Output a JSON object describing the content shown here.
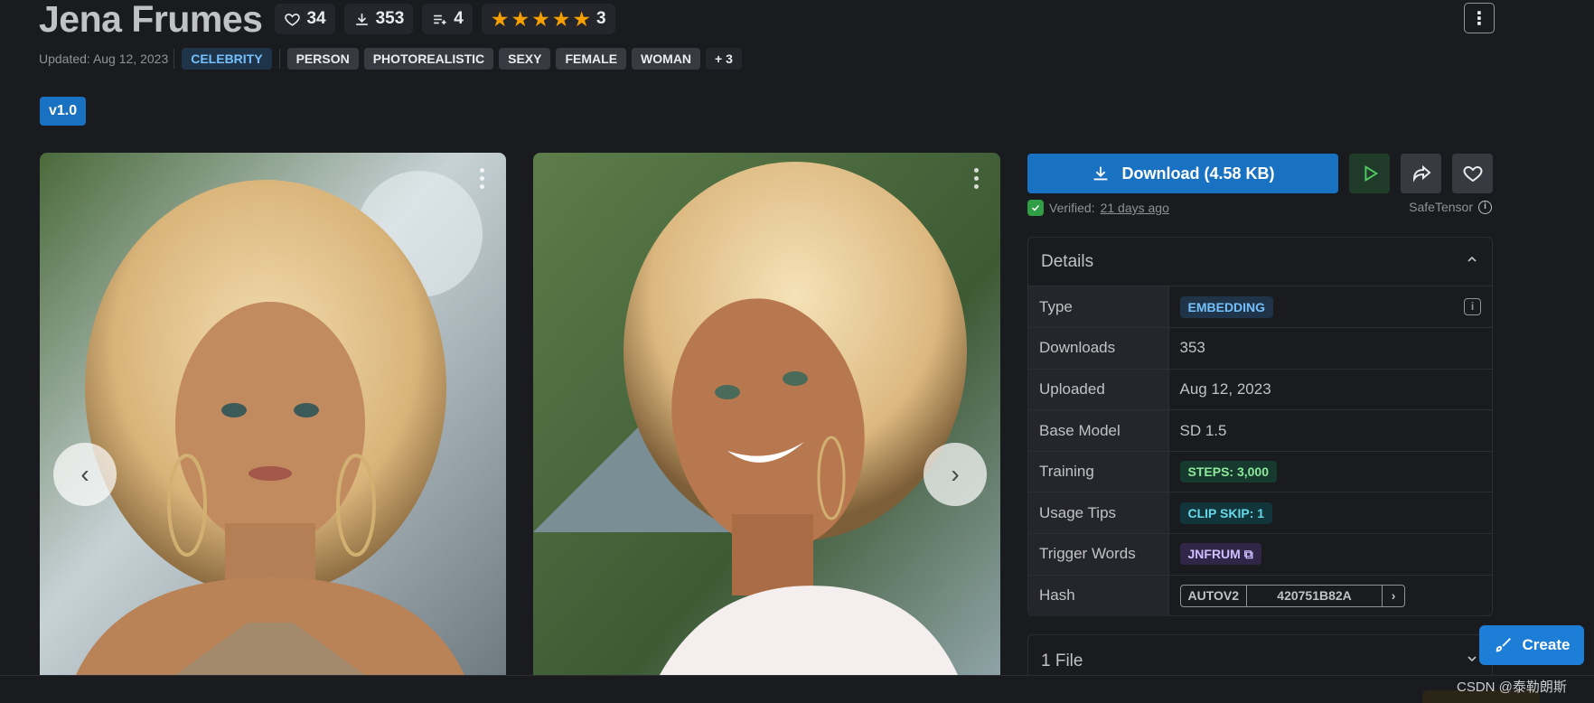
{
  "header": {
    "title": "Jena Frumes",
    "likes": "34",
    "downloads": "353",
    "collections": "4",
    "rating_count": "3",
    "rating_stars": 5
  },
  "meta": {
    "updated": "Updated: Aug 12, 2023",
    "tags": [
      "CELEBRITY",
      "PERSON",
      "PHOTOREALISTIC",
      "SEXY",
      "FEMALE",
      "WOMAN"
    ],
    "more_tags": "+ 3"
  },
  "version_label": "v1.0",
  "gallery": {
    "prev_icon": "chevron-left-icon",
    "next_icon": "chevron-right-icon"
  },
  "actions": {
    "download_label": "Download (4.58 KB)",
    "verified_prefix": "Verified:",
    "verified_when": "21 days ago",
    "safetensor_label": "SafeTensor"
  },
  "details": {
    "title": "Details",
    "rows": [
      {
        "key": "Type",
        "value": "EMBEDDING"
      },
      {
        "key": "Downloads",
        "value": "353"
      },
      {
        "key": "Uploaded",
        "value": "Aug 12, 2023"
      },
      {
        "key": "Base Model",
        "value": "SD 1.5"
      },
      {
        "key": "Training",
        "value": "STEPS: 3,000"
      },
      {
        "key": "Usage Tips",
        "value": "CLIP SKIP: 1"
      },
      {
        "key": "Trigger Words",
        "value": "JNFRUM"
      },
      {
        "key": "Hash",
        "algo": "AUTOV2",
        "value": "420751B82A"
      }
    ]
  },
  "files": {
    "label": "1 File"
  },
  "create_label": "Create",
  "watermark": "CSDN @泰勒朗斯",
  "colors": {
    "background": "#1a1b1e",
    "primary": "#1971c2",
    "star": "#f59f00",
    "verified": "#2f9e44"
  }
}
